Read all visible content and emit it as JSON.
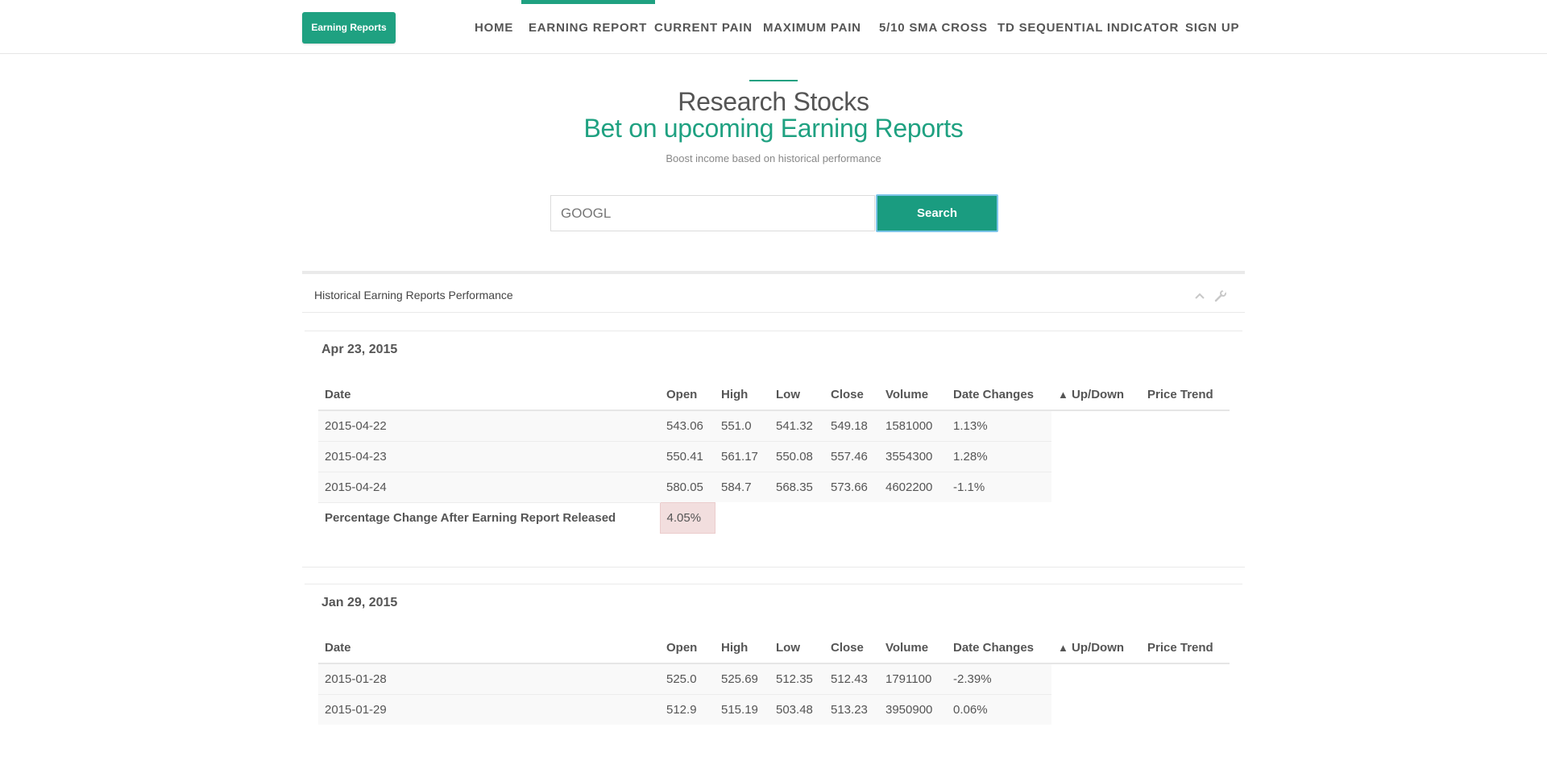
{
  "brand": {
    "label": "Earning Reports"
  },
  "nav": {
    "items": [
      {
        "label": "HOME"
      },
      {
        "label": "EARNING REPORT",
        "active": true
      },
      {
        "label": "CURRENT PAIN"
      },
      {
        "label": "MAXIMUM PAIN"
      },
      {
        "label": "5/10 SMA CROSS"
      },
      {
        "label": "TD SEQUENTIAL INDICATOR"
      },
      {
        "label": "SIGN UP"
      }
    ]
  },
  "hero": {
    "title": "Research Stocks",
    "subtitle": "Bet on upcoming Earning Reports",
    "tagline": "Boost income based on historical performance"
  },
  "search": {
    "value": "GOOGL",
    "button_label": "Search"
  },
  "panel": {
    "title": "Historical Earning Reports Performance",
    "columns": [
      "Date",
      "Open",
      "High",
      "Low",
      "Close",
      "Volume",
      "Date Changes",
      "Up/Down",
      "Price Trend"
    ],
    "up_arrow": "▲",
    "summary_label": "Percentage Change After Earning Report Released",
    "reports": [
      {
        "date": "Apr 23, 2015",
        "rows": [
          {
            "date": "2015-04-22",
            "open": "543.06",
            "high": "551.0",
            "low": "541.32",
            "close": "549.18",
            "volume": "1581000",
            "change": "1.13%"
          },
          {
            "date": "2015-04-23",
            "open": "550.41",
            "high": "561.17",
            "low": "550.08",
            "close": "557.46",
            "volume": "3554300",
            "change": "1.28%"
          },
          {
            "date": "2015-04-24",
            "open": "580.05",
            "high": "584.7",
            "low": "568.35",
            "close": "573.66",
            "volume": "4602200",
            "change": "-1.1%"
          }
        ],
        "percentage_change": "4.05%"
      },
      {
        "date": "Jan 29, 2015",
        "rows": [
          {
            "date": "2015-01-28",
            "open": "525.0",
            "high": "525.69",
            "low": "512.35",
            "close": "512.43",
            "volume": "1791100",
            "change": "-2.39%"
          },
          {
            "date": "2015-01-29",
            "open": "512.9",
            "high": "515.19",
            "low": "503.48",
            "close": "513.23",
            "volume": "3950900",
            "change": "0.06%"
          }
        ]
      }
    ]
  },
  "colors": {
    "accent": "#1fa181",
    "negative_bg": "#f2dede"
  }
}
